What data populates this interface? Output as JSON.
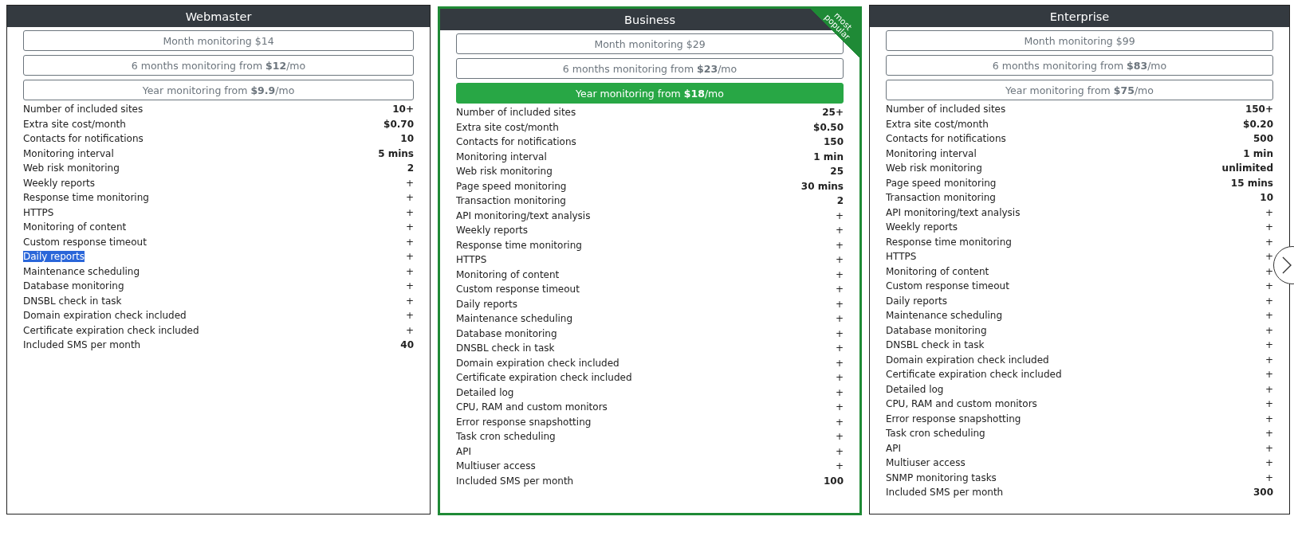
{
  "plans": [
    {
      "name": "Webmaster",
      "featured": false,
      "options": [
        {
          "text": "Month monitoring $14",
          "selected": false
        },
        {
          "text": "6 months monitoring from **$12**/mo",
          "selected": false
        },
        {
          "text": "Year monitoring from **$9.9**/mo",
          "selected": false
        }
      ],
      "features": [
        {
          "label": "Number of included sites",
          "value": "10+",
          "kind": "value",
          "selected": false
        },
        {
          "label": "Extra site cost/month",
          "value": "$0.70",
          "kind": "value",
          "selected": false
        },
        {
          "label": "Contacts for notifications",
          "value": "10",
          "kind": "value",
          "selected": false
        },
        {
          "label": "Monitoring interval",
          "value": "5 mins",
          "kind": "value",
          "selected": false
        },
        {
          "label": "Web risk monitoring",
          "value": "2",
          "kind": "value",
          "selected": false
        },
        {
          "label": "Weekly reports",
          "value": "+",
          "kind": "flag",
          "selected": false
        },
        {
          "label": "Response time monitoring",
          "value": "+",
          "kind": "flag",
          "selected": false
        },
        {
          "label": "HTTPS",
          "value": "+",
          "kind": "flag",
          "selected": false
        },
        {
          "label": "Monitoring of content",
          "value": "+",
          "kind": "flag",
          "selected": false
        },
        {
          "label": "Custom response timeout",
          "value": "+",
          "kind": "flag",
          "selected": false
        },
        {
          "label": "Daily reports",
          "value": "+",
          "kind": "flag",
          "selected": true
        },
        {
          "label": "Maintenance scheduling",
          "value": "+",
          "kind": "flag",
          "selected": false
        },
        {
          "label": "Database monitoring",
          "value": "+",
          "kind": "flag",
          "selected": false
        },
        {
          "label": "DNSBL check in task",
          "value": "+",
          "kind": "flag",
          "selected": false
        },
        {
          "label": "Domain expiration check included",
          "value": "+",
          "kind": "flag",
          "selected": false
        },
        {
          "label": "Certificate expiration check included",
          "value": "+",
          "kind": "flag",
          "selected": false
        },
        {
          "label": "Included SMS per month",
          "value": "40",
          "kind": "value",
          "selected": false
        }
      ]
    },
    {
      "name": "Business",
      "featured": true,
      "ribbon": "most popular",
      "options": [
        {
          "text": "Month monitoring $29",
          "selected": false
        },
        {
          "text": "6 months monitoring from **$23**/mo",
          "selected": false
        },
        {
          "text": "Year monitoring from **$18**/mo",
          "selected": true
        }
      ],
      "features": [
        {
          "label": "Number of included sites",
          "value": "25+",
          "kind": "value",
          "selected": false
        },
        {
          "label": "Extra site cost/month",
          "value": "$0.50",
          "kind": "value",
          "selected": false
        },
        {
          "label": "Contacts for notifications",
          "value": "150",
          "kind": "value",
          "selected": false
        },
        {
          "label": "Monitoring interval",
          "value": "1 min",
          "kind": "value",
          "selected": false
        },
        {
          "label": "Web risk monitoring",
          "value": "25",
          "kind": "value",
          "selected": false
        },
        {
          "label": "Page speed monitoring",
          "value": "30 mins",
          "kind": "value",
          "selected": false
        },
        {
          "label": "Transaction monitoring",
          "value": "2",
          "kind": "value",
          "selected": false
        },
        {
          "label": "API monitoring/text analysis",
          "value": "+",
          "kind": "flag",
          "selected": false
        },
        {
          "label": "Weekly reports",
          "value": "+",
          "kind": "flag",
          "selected": false
        },
        {
          "label": "Response time monitoring",
          "value": "+",
          "kind": "flag",
          "selected": false
        },
        {
          "label": "HTTPS",
          "value": "+",
          "kind": "flag",
          "selected": false
        },
        {
          "label": "Monitoring of content",
          "value": "+",
          "kind": "flag",
          "selected": false
        },
        {
          "label": "Custom response timeout",
          "value": "+",
          "kind": "flag",
          "selected": false
        },
        {
          "label": "Daily reports",
          "value": "+",
          "kind": "flag",
          "selected": false
        },
        {
          "label": "Maintenance scheduling",
          "value": "+",
          "kind": "flag",
          "selected": false
        },
        {
          "label": "Database monitoring",
          "value": "+",
          "kind": "flag",
          "selected": false
        },
        {
          "label": "DNSBL check in task",
          "value": "+",
          "kind": "flag",
          "selected": false
        },
        {
          "label": "Domain expiration check included",
          "value": "+",
          "kind": "flag",
          "selected": false
        },
        {
          "label": "Certificate expiration check included",
          "value": "+",
          "kind": "flag",
          "selected": false
        },
        {
          "label": "Detailed log",
          "value": "+",
          "kind": "flag",
          "selected": false
        },
        {
          "label": "CPU, RAM and custom monitors",
          "value": "+",
          "kind": "flag",
          "selected": false
        },
        {
          "label": "Error response snapshotting",
          "value": "+",
          "kind": "flag",
          "selected": false
        },
        {
          "label": "Task cron scheduling",
          "value": "+",
          "kind": "flag",
          "selected": false
        },
        {
          "label": "API",
          "value": "+",
          "kind": "flag",
          "selected": false
        },
        {
          "label": "Multiuser access",
          "value": "+",
          "kind": "flag",
          "selected": false
        },
        {
          "label": "Included SMS per month",
          "value": "100",
          "kind": "value",
          "selected": false
        }
      ]
    },
    {
      "name": "Enterprise",
      "featured": false,
      "options": [
        {
          "text": "Month monitoring $99",
          "selected": false
        },
        {
          "text": "6 months monitoring from **$83**/mo",
          "selected": false
        },
        {
          "text": "Year monitoring from **$75**/mo",
          "selected": false
        }
      ],
      "features": [
        {
          "label": "Number of included sites",
          "value": "150+",
          "kind": "value",
          "selected": false
        },
        {
          "label": "Extra site cost/month",
          "value": "$0.20",
          "kind": "value",
          "selected": false
        },
        {
          "label": "Contacts for notifications",
          "value": "500",
          "kind": "value",
          "selected": false
        },
        {
          "label": "Monitoring interval",
          "value": "1 min",
          "kind": "value",
          "selected": false
        },
        {
          "label": "Web risk monitoring",
          "value": "unlimited",
          "kind": "value",
          "selected": false
        },
        {
          "label": "Page speed monitoring",
          "value": "15 mins",
          "kind": "value",
          "selected": false
        },
        {
          "label": "Transaction monitoring",
          "value": "10",
          "kind": "value",
          "selected": false
        },
        {
          "label": "API monitoring/text analysis",
          "value": "+",
          "kind": "flag",
          "selected": false
        },
        {
          "label": "Weekly reports",
          "value": "+",
          "kind": "flag",
          "selected": false
        },
        {
          "label": "Response time monitoring",
          "value": "+",
          "kind": "flag",
          "selected": false
        },
        {
          "label": "HTTPS",
          "value": "+",
          "kind": "flag",
          "selected": false
        },
        {
          "label": "Monitoring of content",
          "value": "+",
          "kind": "flag",
          "selected": false
        },
        {
          "label": "Custom response timeout",
          "value": "+",
          "kind": "flag",
          "selected": false
        },
        {
          "label": "Daily reports",
          "value": "+",
          "kind": "flag",
          "selected": false
        },
        {
          "label": "Maintenance scheduling",
          "value": "+",
          "kind": "flag",
          "selected": false
        },
        {
          "label": "Database monitoring",
          "value": "+",
          "kind": "flag",
          "selected": false
        },
        {
          "label": "DNSBL check in task",
          "value": "+",
          "kind": "flag",
          "selected": false
        },
        {
          "label": "Domain expiration check included",
          "value": "+",
          "kind": "flag",
          "selected": false
        },
        {
          "label": "Certificate expiration check included",
          "value": "+",
          "kind": "flag",
          "selected": false
        },
        {
          "label": "Detailed log",
          "value": "+",
          "kind": "flag",
          "selected": false
        },
        {
          "label": "CPU, RAM and custom monitors",
          "value": "+",
          "kind": "flag",
          "selected": false
        },
        {
          "label": "Error response snapshotting",
          "value": "+",
          "kind": "flag",
          "selected": false
        },
        {
          "label": "Task cron scheduling",
          "value": "+",
          "kind": "flag",
          "selected": false
        },
        {
          "label": "API",
          "value": "+",
          "kind": "flag",
          "selected": false
        },
        {
          "label": "Multiuser access",
          "value": "+",
          "kind": "flag",
          "selected": false
        },
        {
          "label": "SNMP monitoring tasks",
          "value": "+",
          "kind": "flag",
          "selected": false
        },
        {
          "label": "Included SMS per month",
          "value": "300",
          "kind": "value",
          "selected": false
        }
      ]
    }
  ]
}
